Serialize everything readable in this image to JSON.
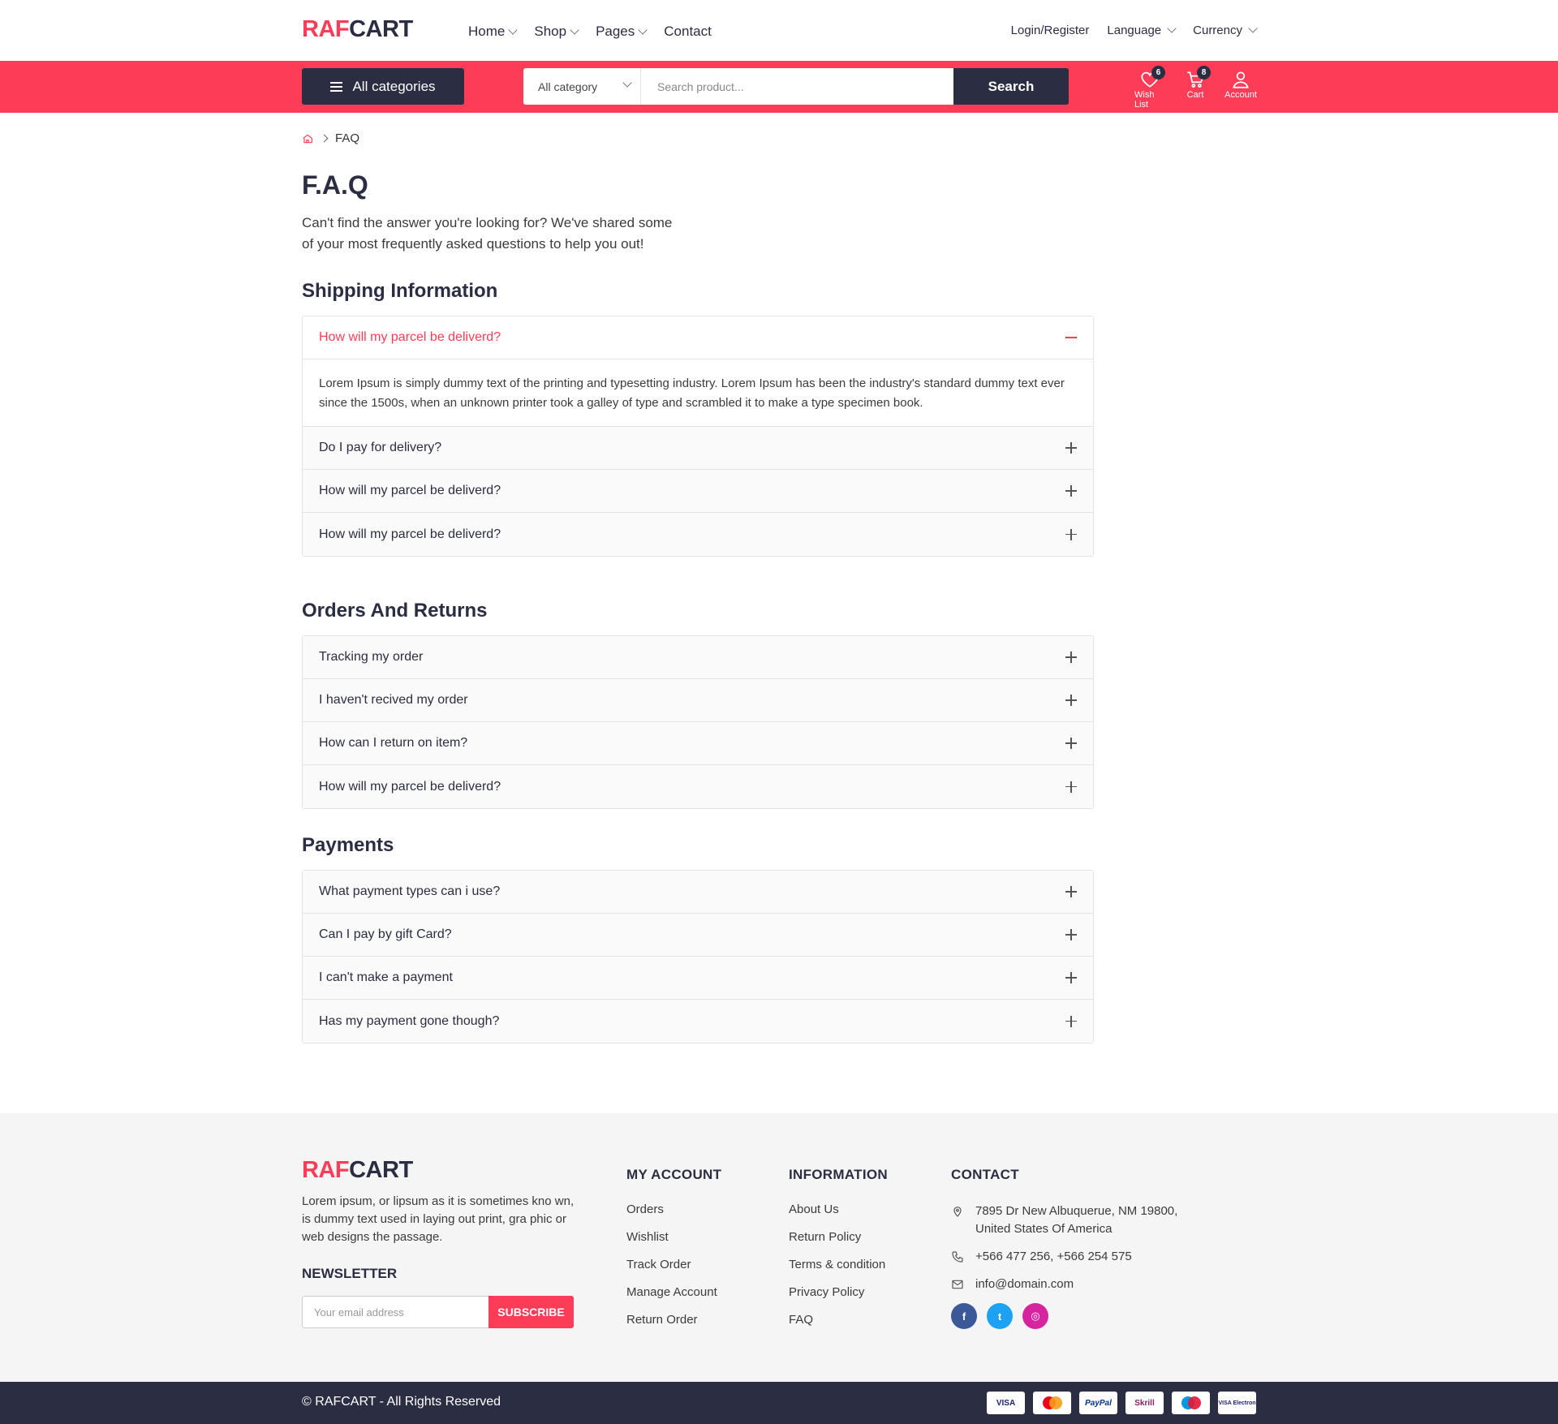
{
  "brand": {
    "part1": "RAF",
    "part2": "CART"
  },
  "nav": {
    "main": [
      {
        "label": "Home",
        "has_dropdown": true
      },
      {
        "label": "Shop",
        "has_dropdown": true
      },
      {
        "label": "Pages",
        "has_dropdown": true
      },
      {
        "label": "Contact",
        "has_dropdown": false
      }
    ],
    "login": "Login/Register",
    "language": "Language",
    "currency": "Currency"
  },
  "searchbar": {
    "all_categories": "All categories",
    "category_select": "All category",
    "placeholder": "Search product...",
    "button": "Search"
  },
  "header_icons": {
    "wishlist": {
      "label": "Wish List",
      "count": "6",
      "icon": "heart-icon"
    },
    "cart": {
      "label": "Cart",
      "count": "8",
      "icon": "cart-icon"
    },
    "account": {
      "label": "Account",
      "icon": "user-icon"
    }
  },
  "breadcrumb": {
    "current": "FAQ"
  },
  "page": {
    "title": "F.A.Q",
    "intro_line1": "Can't find the answer you're looking for? We've shared some",
    "intro_line2": "of your most frequently asked questions to help you out!"
  },
  "sections": [
    {
      "title": "Shipping Information",
      "items": [
        {
          "q": "How will my parcel be deliverd?",
          "open": true,
          "a": "Lorem Ipsum is simply dummy text of the printing and typesetting industry. Lorem Ipsum has been the industry's standard dummy text ever since the 1500s, when an unknown printer took a galley of type and scrambled it to make a type specimen book."
        },
        {
          "q": "Do I pay for delivery?",
          "open": false
        },
        {
          "q": "How will my parcel be deliverd?",
          "open": false
        },
        {
          "q": "How will my parcel be deliverd?",
          "open": false
        }
      ]
    },
    {
      "title": "Orders And Returns",
      "items": [
        {
          "q": "Tracking my order",
          "open": false
        },
        {
          "q": "I haven't recived my order",
          "open": false
        },
        {
          "q": "How can I return on item?",
          "open": false
        },
        {
          "q": "How will my parcel be deliverd?",
          "open": false
        }
      ]
    },
    {
      "title": "Payments",
      "items": [
        {
          "q": "What payment types can i use?",
          "open": false
        },
        {
          "q": "Can I pay by gift Card?",
          "open": false
        },
        {
          "q": "I can't make a payment",
          "open": false
        },
        {
          "q": "Has my payment gone though?",
          "open": false
        }
      ]
    }
  ],
  "footer": {
    "description": "Lorem ipsum, or lipsum as it is sometimes kno wn, is dummy text used in laying out print, gra phic or web designs the passage.",
    "newsletter_title": "NEWSLETTER",
    "newsletter_placeholder": "Your email address",
    "subscribe": "SUBSCRIBE",
    "my_account": {
      "title": "MY ACCOUNT",
      "links": [
        "Orders",
        "Wishlist",
        "Track Order",
        "Manage Account",
        "Return Order"
      ]
    },
    "information": {
      "title": "INFORMATION",
      "links": [
        "About Us",
        "Return Policy",
        "Terms & condition",
        "Privacy Policy",
        "FAQ"
      ]
    },
    "contact": {
      "title": "CONTACT",
      "address_line1": "7895 Dr New Albuquerue, NM 19800,",
      "address_line2": "United States Of America",
      "phone": "+566 477 256, +566 254 575",
      "email": "info@domain.com"
    },
    "socials": [
      {
        "name": "facebook-icon",
        "glyph": "f",
        "color": "#3b5998"
      },
      {
        "name": "twitter-icon",
        "glyph": "t",
        "color": "#1da1f2"
      },
      {
        "name": "instagram-icon",
        "glyph": "◎",
        "color": "#d6249f"
      }
    ]
  },
  "bottom": {
    "copyright": "© RAFCART - All Rights Reserved",
    "payments": [
      "VISA",
      "Mastercard",
      "PayPal",
      "Skrill",
      "Maestro",
      "VISA Electron"
    ]
  },
  "colors": {
    "accent": "#fd3d57",
    "dark": "#2b2d42"
  }
}
